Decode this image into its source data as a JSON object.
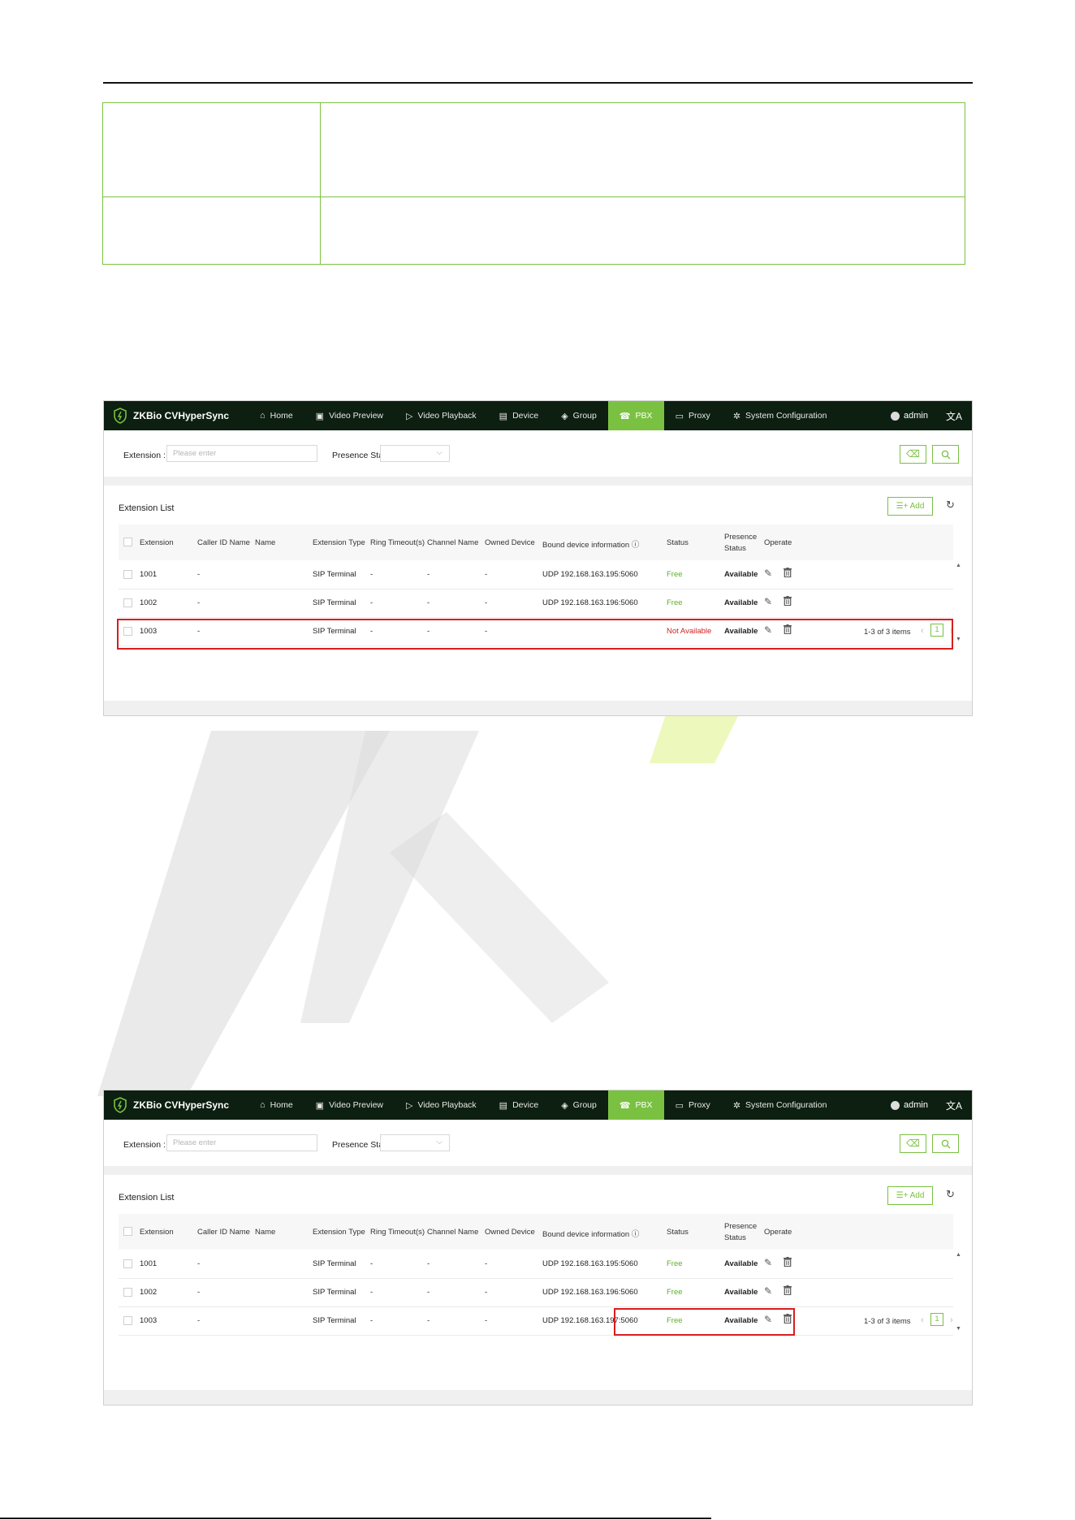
{
  "header_rule": true,
  "info_table": {
    "rows": [
      [
        "",
        ""
      ],
      [
        "",
        ""
      ]
    ]
  },
  "screens": [
    {
      "brand": "ZKBio CVHyperSync",
      "nav": [
        {
          "icon": "home-icon",
          "glyph": "⌂",
          "label": "Home"
        },
        {
          "icon": "video-preview-icon",
          "glyph": "▣",
          "label": "Video Preview"
        },
        {
          "icon": "video-playback-icon",
          "glyph": "▷",
          "label": "Video Playback"
        },
        {
          "icon": "device-icon",
          "glyph": "▤",
          "label": "Device"
        },
        {
          "icon": "group-icon",
          "glyph": "◈",
          "label": "Group"
        },
        {
          "icon": "pbx-icon",
          "glyph": "☎",
          "label": "PBX",
          "active": true
        },
        {
          "icon": "proxy-icon",
          "glyph": "▭",
          "label": "Proxy"
        },
        {
          "icon": "gear-icon",
          "glyph": "✲",
          "label": "System Configuration"
        }
      ],
      "user": "admin",
      "lang_glyph": "文A",
      "filter": {
        "extension_label": "Extension :",
        "extension_placeholder": "Please enter",
        "presence_label": "Presence Stat"
      },
      "list_title": "Extension List",
      "add_label": "Add",
      "columns": [
        "Extension",
        "Caller ID Name",
        "Name",
        "Extension Type",
        "Ring Timeout(s)",
        "Channel Name",
        "Owned Device",
        "Bound device information ⓘ",
        "Status",
        "Presence Status",
        "Operate"
      ],
      "rows": [
        {
          "extension": "1001",
          "caller_id": "-",
          "name": "",
          "type": "SIP Terminal",
          "ring": "-",
          "channel": "-",
          "owned": "-",
          "bound": "UDP 192.168.163.195:5060",
          "status": "Free",
          "presence": "Available"
        },
        {
          "extension": "1002",
          "caller_id": "-",
          "name": "",
          "type": "SIP Terminal",
          "ring": "-",
          "channel": "-",
          "owned": "-",
          "bound": "UDP 192.168.163.196:5060",
          "status": "Free",
          "presence": "Available"
        },
        {
          "extension": "1003",
          "caller_id": "-",
          "name": "",
          "type": "SIP Terminal",
          "ring": "-",
          "channel": "-",
          "owned": "-",
          "bound": "",
          "status": "Not Available",
          "presence": "Available"
        }
      ],
      "pager_text": "1-3 of 3 items",
      "page": "1"
    },
    {
      "brand": "ZKBio CVHyperSync",
      "nav": [
        {
          "icon": "home-icon",
          "glyph": "⌂",
          "label": "Home"
        },
        {
          "icon": "video-preview-icon",
          "glyph": "▣",
          "label": "Video Preview"
        },
        {
          "icon": "video-playback-icon",
          "glyph": "▷",
          "label": "Video Playback"
        },
        {
          "icon": "device-icon",
          "glyph": "▤",
          "label": "Device"
        },
        {
          "icon": "group-icon",
          "glyph": "◈",
          "label": "Group"
        },
        {
          "icon": "pbx-icon",
          "glyph": "☎",
          "label": "PBX",
          "active": true
        },
        {
          "icon": "proxy-icon",
          "glyph": "▭",
          "label": "Proxy"
        },
        {
          "icon": "gear-icon",
          "glyph": "✲",
          "label": "System Configuration"
        }
      ],
      "user": "admin",
      "lang_glyph": "文A",
      "filter": {
        "extension_label": "Extension :",
        "extension_placeholder": "Please enter",
        "presence_label": "Presence Stat"
      },
      "list_title": "Extension List",
      "add_label": "Add",
      "columns": [
        "Extension",
        "Caller ID Name",
        "Name",
        "Extension Type",
        "Ring Timeout(s)",
        "Channel Name",
        "Owned Device",
        "Bound device information ⓘ",
        "Status",
        "Presence Status",
        "Operate"
      ],
      "rows": [
        {
          "extension": "1001",
          "caller_id": "-",
          "name": "",
          "type": "SIP Terminal",
          "ring": "-",
          "channel": "-",
          "owned": "-",
          "bound": "UDP 192.168.163.195:5060",
          "status": "Free",
          "presence": "Available"
        },
        {
          "extension": "1002",
          "caller_id": "-",
          "name": "",
          "type": "SIP Terminal",
          "ring": "-",
          "channel": "-",
          "owned": "-",
          "bound": "UDP 192.168.163.196:5060",
          "status": "Free",
          "presence": "Available"
        },
        {
          "extension": "1003",
          "caller_id": "-",
          "name": "",
          "type": "SIP Terminal",
          "ring": "-",
          "channel": "-",
          "owned": "-",
          "bound": "UDP 192.168.163.197:5060",
          "status": "Free",
          "presence": "Available"
        }
      ],
      "pager_text": "1-3 of 3 items",
      "page": "1"
    }
  ],
  "colors": {
    "accent": "#7ac142",
    "nav_bg": "#0c1f10",
    "free": "#5fae2b",
    "not_available": "#d42020",
    "highlight": "#d71e1e"
  }
}
